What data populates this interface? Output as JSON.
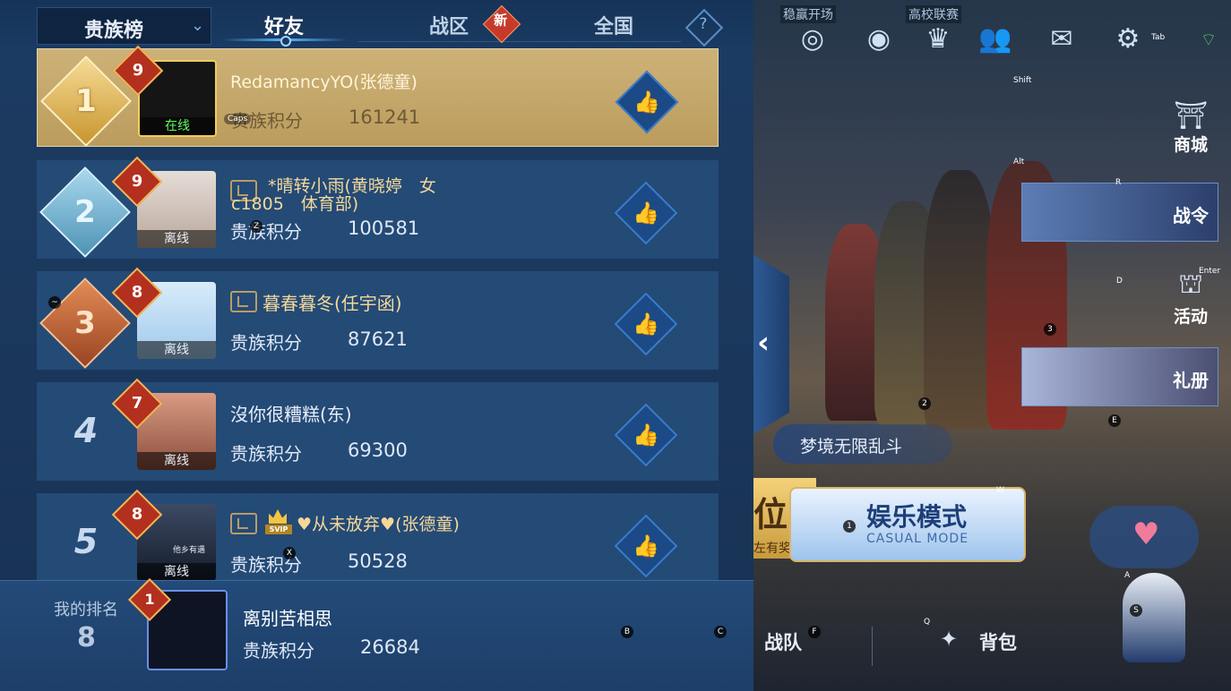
{
  "header": {
    "dropdown_label": "贵族榜",
    "tabs": [
      {
        "label": "好友",
        "active": true
      },
      {
        "label": "战区",
        "badge": "新"
      },
      {
        "label": "全国"
      }
    ],
    "help_label": "?"
  },
  "score_label": "贵族积分",
  "rows": [
    {
      "rank": "1",
      "level": "9",
      "name": "RedamancyYO(张德童)",
      "status": "在线",
      "score": "161241"
    },
    {
      "rank": "2",
      "level": "9",
      "name": "*晴转小雨(黄晓婷　女",
      "name_line2": "c1805　体育部)",
      "status": "离线",
      "score": "100581"
    },
    {
      "rank": "3",
      "level": "8",
      "name": "暮春暮冬(任宇函)",
      "status": "离线",
      "score": "87621"
    },
    {
      "rank": "4",
      "level": "7",
      "name": "沒你很糟糕(东)",
      "status": "离线",
      "score": "69300"
    },
    {
      "rank": "5",
      "level": "8",
      "name": "♥从未放弃♥(张德童)",
      "status": "离线",
      "score": "50528",
      "vip": "SVIP"
    }
  ],
  "my_rank": {
    "label": "我的排名",
    "rank": "8",
    "level": "1",
    "name": "离别苦相思",
    "score": "26684"
  },
  "scene": {
    "top_labels": [
      "稳赢开场",
      "高校联赛"
    ],
    "top_icons": [
      "target-icon",
      "eye-icon",
      "trophy-icon",
      "friends-icon",
      "mail-icon",
      "gear-icon",
      "wifi-icon"
    ],
    "side_items": [
      {
        "icon": "shop-icon",
        "label": "商城"
      },
      {
        "icon": "battlepass-icon",
        "label": "战令"
      },
      {
        "icon": "event-icon",
        "label": "活动"
      },
      {
        "icon": "gift-icon",
        "label": "礼册"
      }
    ],
    "dream_label": "梦境无限乱斗",
    "rank_mode_title": "位",
    "rank_mode_sub": "左有奖",
    "casual_title": "娱乐模式",
    "casual_sub": "CASUAL MODE",
    "team_label": "战队",
    "bag_label": "背包",
    "heart_icon": "♥"
  },
  "key_hints": {
    "tab": "Tab",
    "shift": "Shift",
    "alt": "Alt",
    "r": "R",
    "enter": "Enter",
    "d": "D",
    "three": "3",
    "two": "2",
    "e": "E",
    "w": "W",
    "one": "1",
    "a": "A",
    "s": "S",
    "q": "Q",
    "f": "F",
    "b": "B",
    "c": "C",
    "x": "X",
    "z": "Z",
    "caps": "Caps",
    "tilde": "~"
  },
  "extra_text": {
    "avatar5_overlay": "他乡有遇"
  },
  "colors": {
    "panel_bg": "#1d3c63",
    "row_bg": "#244a76",
    "first_row_gold": "#cdb278",
    "name_gold": "#f4d89a",
    "level_red": "#b3301e",
    "online_green": "#5dff5d"
  }
}
